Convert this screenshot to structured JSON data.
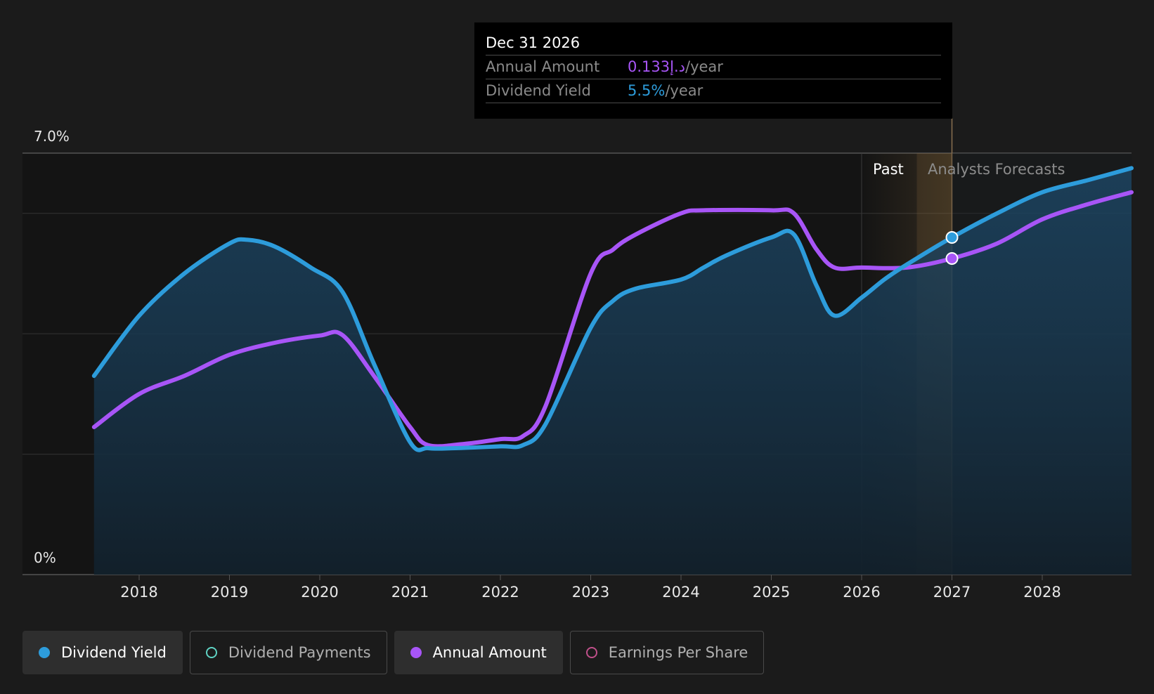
{
  "tooltip": {
    "date": "Dec 31 2026",
    "rows": [
      {
        "label": "Annual Amount",
        "value": "0.133د.إ",
        "unit": "/year",
        "color": "#a855f7"
      },
      {
        "label": "Dividend Yield",
        "value": "5.5%",
        "unit": "/year",
        "color": "#2d9cdb"
      }
    ]
  },
  "regions": {
    "past": "Past",
    "forecast": "Analysts Forecasts"
  },
  "legend": [
    {
      "label": "Dividend Yield",
      "color": "#2d9cdb",
      "filled": true,
      "active": true
    },
    {
      "label": "Dividend Payments",
      "color": "#5fd3c4",
      "filled": false,
      "active": false
    },
    {
      "label": "Annual Amount",
      "color": "#a855f7",
      "filled": true,
      "active": true
    },
    {
      "label": "Earnings Per Share",
      "color": "#c0508a",
      "filled": false,
      "active": false
    }
  ],
  "chart_data": {
    "type": "line",
    "ylim": [
      0,
      7.0
    ],
    "y_tick_labels": [
      "7.0%",
      "0%"
    ],
    "x_tick_labels": [
      "2018",
      "2019",
      "2020",
      "2021",
      "2022",
      "2023",
      "2024",
      "2025",
      "2026",
      "2027",
      "2028"
    ],
    "xlim": [
      2017.0,
      2029.0
    ],
    "forecast_start": 2026.0,
    "highlight_x": 2027.0,
    "grid": true,
    "series": [
      {
        "name": "Dividend Yield",
        "color": "#2d9cdb",
        "area": true,
        "x": [
          2017.5,
          2018.0,
          2018.5,
          2019.0,
          2019.2,
          2019.5,
          2019.9,
          2020.25,
          2020.6,
          2021.0,
          2021.2,
          2021.5,
          2022.0,
          2022.25,
          2022.5,
          2023.0,
          2023.25,
          2023.5,
          2024.0,
          2024.25,
          2024.5,
          2025.0,
          2025.25,
          2025.5,
          2025.7,
          2026.0,
          2026.25,
          2026.5,
          2027.0,
          2027.5,
          2028.0,
          2028.5,
          2029.0
        ],
        "y": [
          3.3,
          4.3,
          5.0,
          5.5,
          5.56,
          5.45,
          5.1,
          4.7,
          3.5,
          2.2,
          2.1,
          2.1,
          2.13,
          2.15,
          2.5,
          4.1,
          4.55,
          4.75,
          4.9,
          5.1,
          5.3,
          5.6,
          5.65,
          4.8,
          4.3,
          4.6,
          4.9,
          5.15,
          5.6,
          6.0,
          6.35,
          6.55,
          6.75
        ]
      },
      {
        "name": "Annual Amount",
        "color": "#a855f7",
        "area": false,
        "x": [
          2017.5,
          2018.0,
          2018.5,
          2019.0,
          2019.5,
          2020.0,
          2020.25,
          2020.6,
          2021.0,
          2021.2,
          2021.6,
          2022.0,
          2022.25,
          2022.5,
          2023.0,
          2023.25,
          2023.5,
          2024.0,
          2024.25,
          2025.0,
          2025.25,
          2025.5,
          2025.7,
          2026.0,
          2026.5,
          2027.0,
          2027.5,
          2028.0,
          2028.5,
          2029.0
        ],
        "y": [
          2.45,
          3.0,
          3.3,
          3.65,
          3.85,
          3.97,
          3.98,
          3.3,
          2.45,
          2.15,
          2.17,
          2.25,
          2.3,
          2.8,
          5.0,
          5.4,
          5.65,
          6.0,
          6.05,
          6.05,
          6.0,
          5.4,
          5.1,
          5.1,
          5.1,
          5.25,
          5.5,
          5.9,
          6.15,
          6.35
        ]
      }
    ]
  }
}
